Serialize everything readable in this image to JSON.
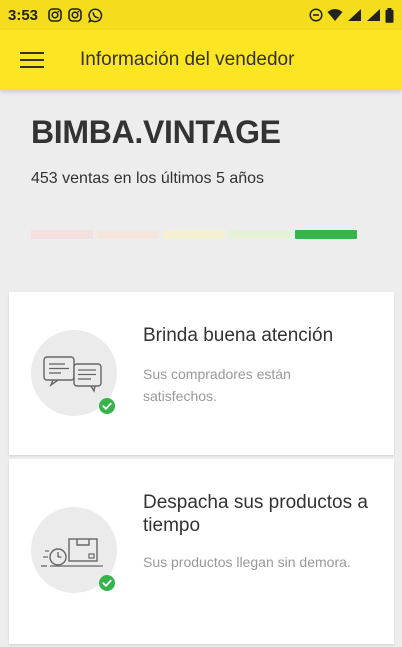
{
  "status_bar": {
    "time": "3:53",
    "left_icons": [
      "instagram-icon",
      "instagram-icon",
      "whatsapp-icon"
    ],
    "right_icons": [
      "do-not-disturb-icon",
      "wifi-icon",
      "signal-icon",
      "battery-icon"
    ]
  },
  "app_bar": {
    "title": "Información del vendedor",
    "menu_icon": "hamburger-menu-icon"
  },
  "seller": {
    "name": "BIMBA.VINTAGE",
    "sales_summary": "453 ventas en los últimos 5 años",
    "reputation": {
      "level": 5,
      "levels": 5,
      "segment_colors": [
        "#f4e0e0",
        "#f5e7de",
        "#f4f1d2",
        "#e7f1d5",
        "#36b34a"
      ]
    }
  },
  "cards": [
    {
      "icon": "chat-bubbles-icon",
      "badge": "check-icon",
      "title": "Brinda buena atención",
      "description": "Sus compradores están satisfechos."
    },
    {
      "icon": "delivery-box-clock-icon",
      "badge": "check-icon",
      "title": "Despacha sus productos a tiempo",
      "description": "Sus productos llegan sin demora."
    }
  ],
  "colors": {
    "status_bar": "#f4dd1c",
    "app_bar": "#fce522",
    "background": "#ededed",
    "success_green": "#36b34a"
  }
}
